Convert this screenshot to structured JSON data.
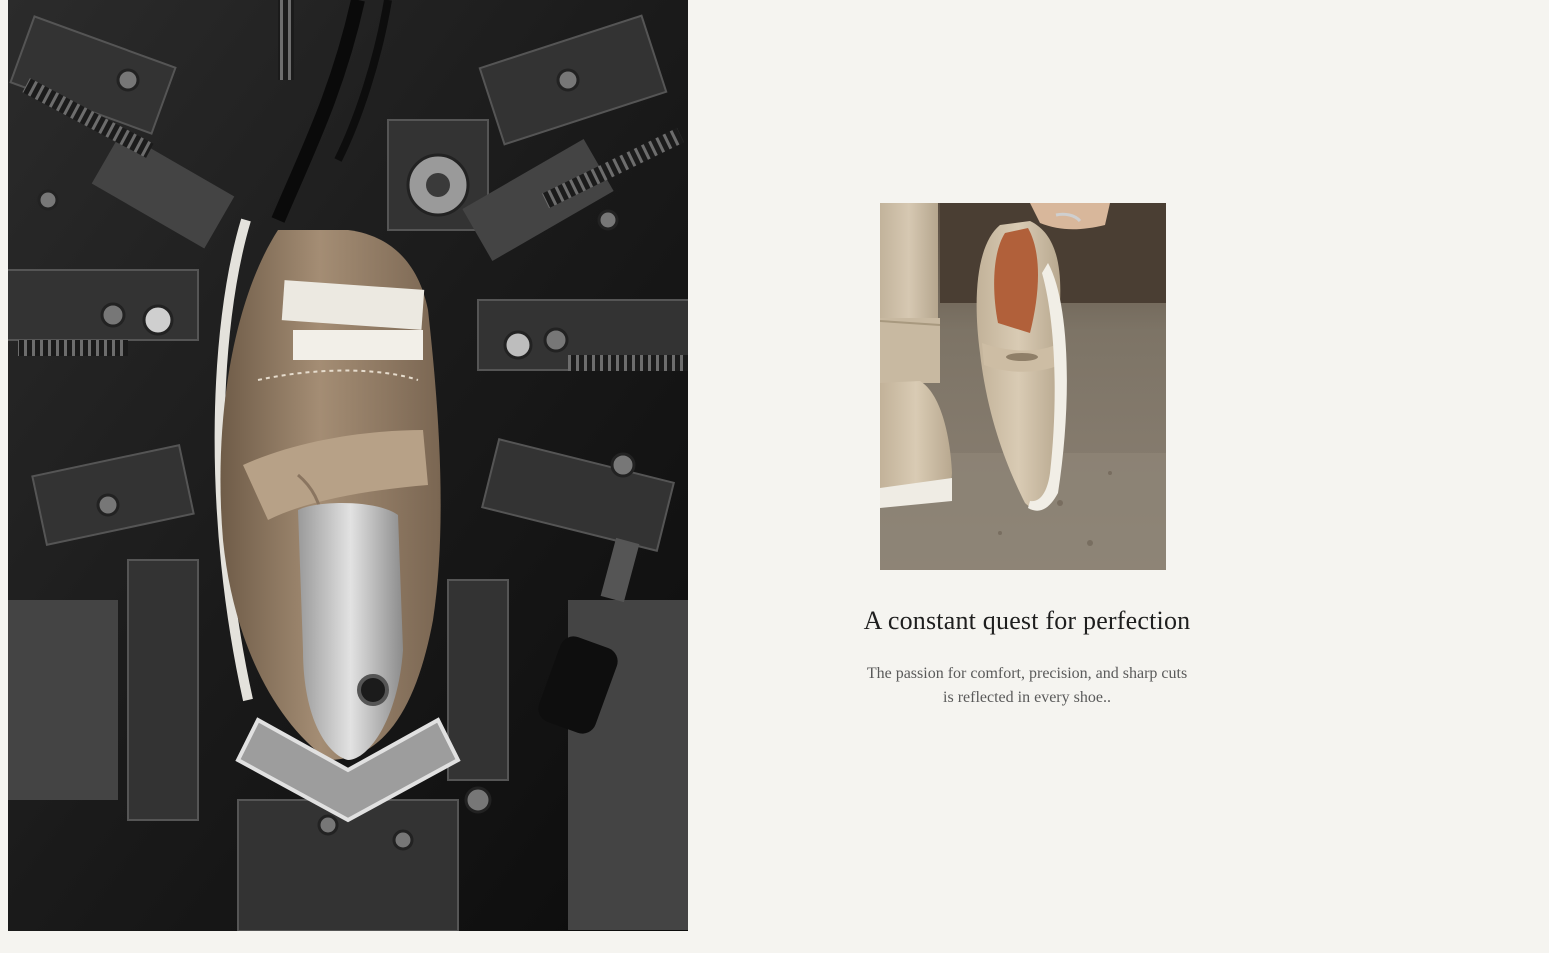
{
  "section": {
    "headline": "A constant quest for perfection",
    "body": "The passion for comfort, precision, and sharp cuts is reflected in every shoe.."
  },
  "images": {
    "hero": "shoe-machinery-photo",
    "product": "suede-loafer-photo"
  },
  "colors": {
    "background": "#f5f4f0",
    "headline": "#1e1e1e",
    "body": "#5a5a5a",
    "suede": "#c9b79c"
  }
}
